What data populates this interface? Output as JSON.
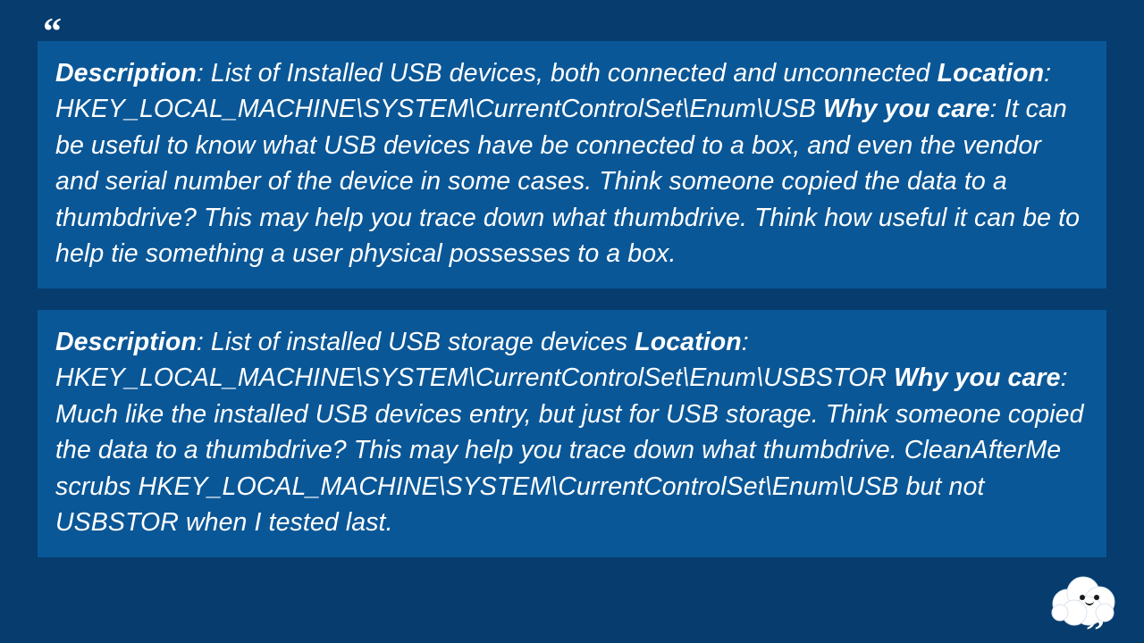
{
  "quote_open": "“",
  "quote_close": "”",
  "blocks": [
    {
      "desc_label": "Description",
      "desc_text": ": List of Installed USB devices, both connected and unconnected ",
      "loc_label": "Location",
      "loc_text": ": HKEY_LOCAL_MACHINE\\SYSTEM\\CurrentControlSet\\Enum\\USB ",
      "why_label": "Why you care",
      "why_text": ": It can be useful to know what USB devices have be connected to a box, and even the vendor and serial number of the device in some cases. Think someone copied the data to a thumbdrive? This may help you trace down what thumbdrive. Think how useful it can be to help tie something a user physical possesses to a box."
    },
    {
      "desc_label": "Description",
      "desc_text": ": List of installed USB storage devices ",
      "loc_label": "Location",
      "loc_text": ": HKEY_LOCAL_MACHINE\\SYSTEM\\CurrentControlSet\\Enum\\USBSTOR ",
      "why_label": "Why you care",
      "why_text": ": Much like the installed USB devices entry, but just for USB storage. Think someone copied the data to a thumbdrive? This may help you trace down what thumbdrive. CleanAfterMe scrubs HKEY_LOCAL_MACHINE\\SYSTEM\\CurrentControlSet\\Enum\\USB but not USBSTOR when I tested last."
    }
  ]
}
